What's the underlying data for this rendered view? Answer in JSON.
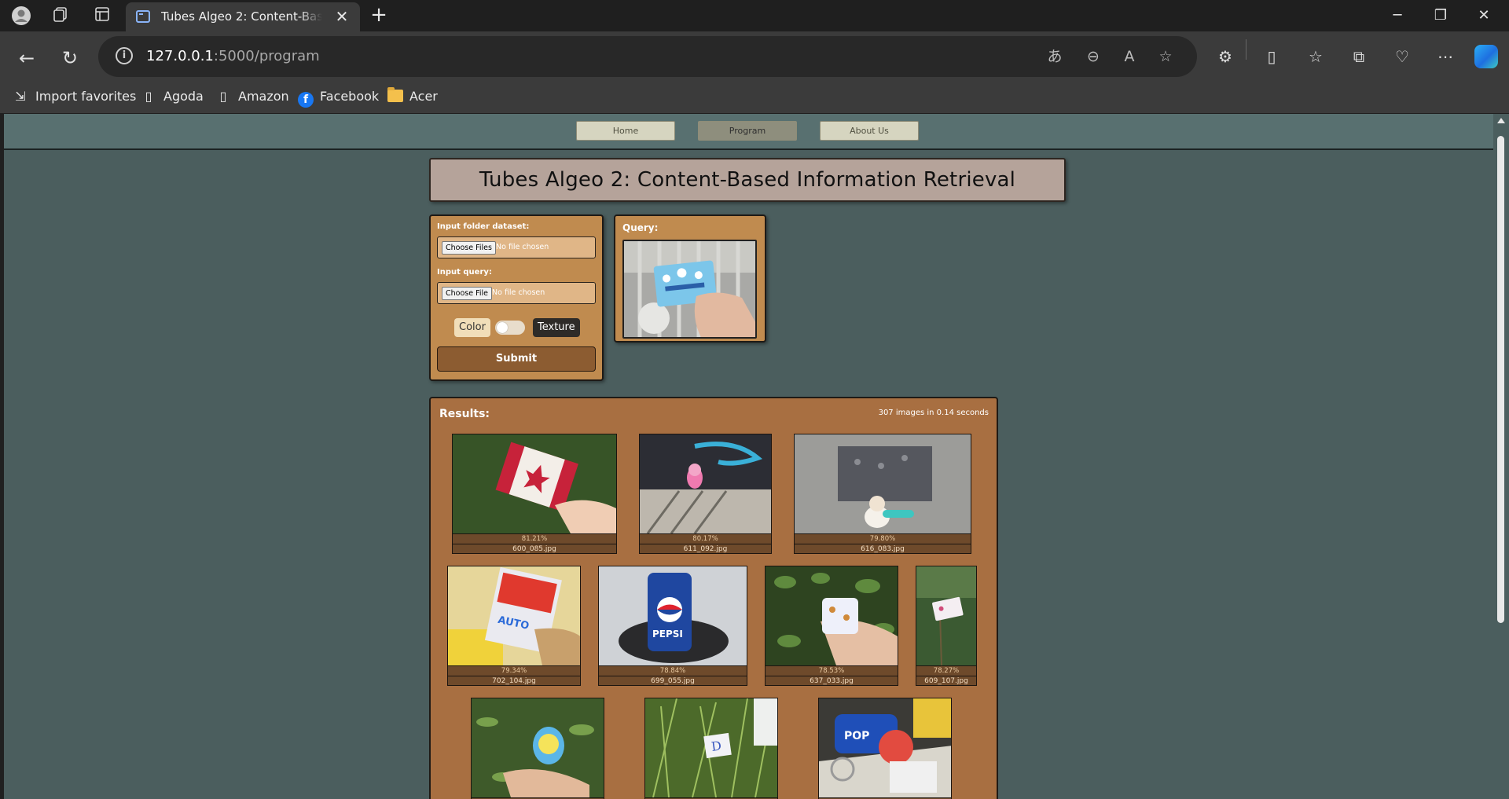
{
  "browser": {
    "tab_title": "Tubes Algeo 2: Content-Based Information Retrieval",
    "url_host": "127.0.0.1",
    "url_path": ":5000/program",
    "bookmarks": [
      {
        "label": "Import favorites",
        "icon": "import-favorites-icon"
      },
      {
        "label": "Agoda",
        "icon": "page-icon"
      },
      {
        "label": "Amazon",
        "icon": "page-icon"
      },
      {
        "label": "Facebook",
        "icon": "facebook-icon"
      },
      {
        "label": "Acer",
        "icon": "folder-icon"
      }
    ]
  },
  "nav": {
    "items": [
      "Home",
      "Program",
      "About Us"
    ],
    "active": "Program"
  },
  "header": {
    "title": "Tubes Algeo 2: Content-Based Information Retrieval"
  },
  "inputs": {
    "dataset_label": "Input folder dataset:",
    "dataset_button": "Choose Files",
    "dataset_status": "No file chosen",
    "query_label": "Input query:",
    "query_button": "Choose File",
    "query_status": "No file chosen",
    "mode_left": "Color",
    "mode_right": "Texture",
    "submit": "Submit"
  },
  "query": {
    "label": "Query:"
  },
  "results": {
    "title": "Results:",
    "summary": "307 images in 0.14 seconds",
    "items": [
      {
        "score": "81.21%",
        "file": "600_085.jpg"
      },
      {
        "score": "80.17%",
        "file": "611_092.jpg"
      },
      {
        "score": "79.80%",
        "file": "616_083.jpg"
      },
      {
        "score": "79.34%",
        "file": "702_104.jpg"
      },
      {
        "score": "78.84%",
        "file": "699_055.jpg"
      },
      {
        "score": "78.53%",
        "file": "637_033.jpg"
      },
      {
        "score": "78.27%",
        "file": "609_107.jpg"
      },
      {
        "score": "",
        "file": ""
      },
      {
        "score": "",
        "file": ""
      },
      {
        "score": "",
        "file": ""
      }
    ]
  },
  "colors": {
    "page_bg": "#4b5e5e",
    "card_bg": "#c08b4f",
    "results_bg": "#a86f41",
    "title_bg": "#b5a39a"
  }
}
